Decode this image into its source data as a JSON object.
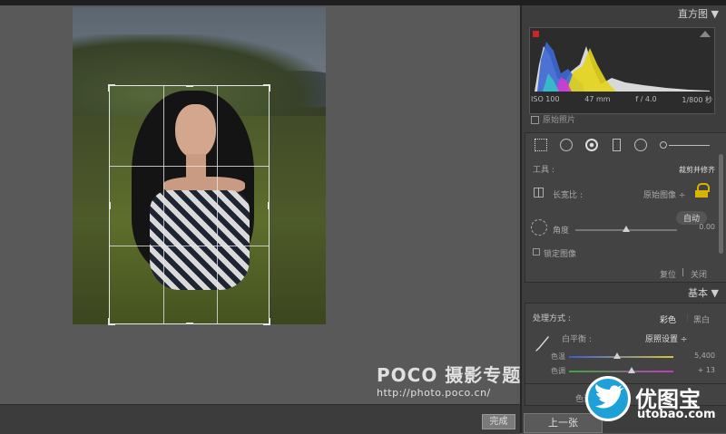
{
  "watermark": {
    "brand": "POCO 摄影专题",
    "url": "http://photo.poco.cn/"
  },
  "bottombar": {
    "done_label": "完成"
  },
  "histogram": {
    "title": "直方图",
    "iso": "ISO 100",
    "focal": "47 mm",
    "aperture": "f / 4.0",
    "shutter": "1/800 秒",
    "original_photo_label": "原始照片"
  },
  "crop_tool": {
    "tool_label": "工具 :",
    "tool_value": "裁剪并修齐",
    "aspect_label": "长宽比 :",
    "aspect_value": "原始图像 ÷",
    "auto_label": "自动",
    "angle_label": "角度",
    "angle_value": "0.00",
    "lock_label": "锁定图像",
    "reset_label": "复位",
    "close_label": "关闭"
  },
  "basic": {
    "title": "基本",
    "treatment_label": "处理方式 :",
    "color_label": "彩色",
    "bw_label": "黑白",
    "wb_label": "白平衡 :",
    "wb_value": "原照设置 ÷",
    "temp_label": "色温",
    "temp_value": "5,400",
    "tint_label": "色调",
    "tint_value": "+ 13",
    "temp_fraction": 0.46,
    "tint_fraction": 0.6,
    "more_label": "色调"
  },
  "nav": {
    "prev_label": "上一张"
  },
  "logo": {
    "name": "优图宝",
    "url": "utobao.com"
  },
  "colors": {
    "accent": "#1da1d8",
    "panel_bg": "#3d3d3d"
  }
}
